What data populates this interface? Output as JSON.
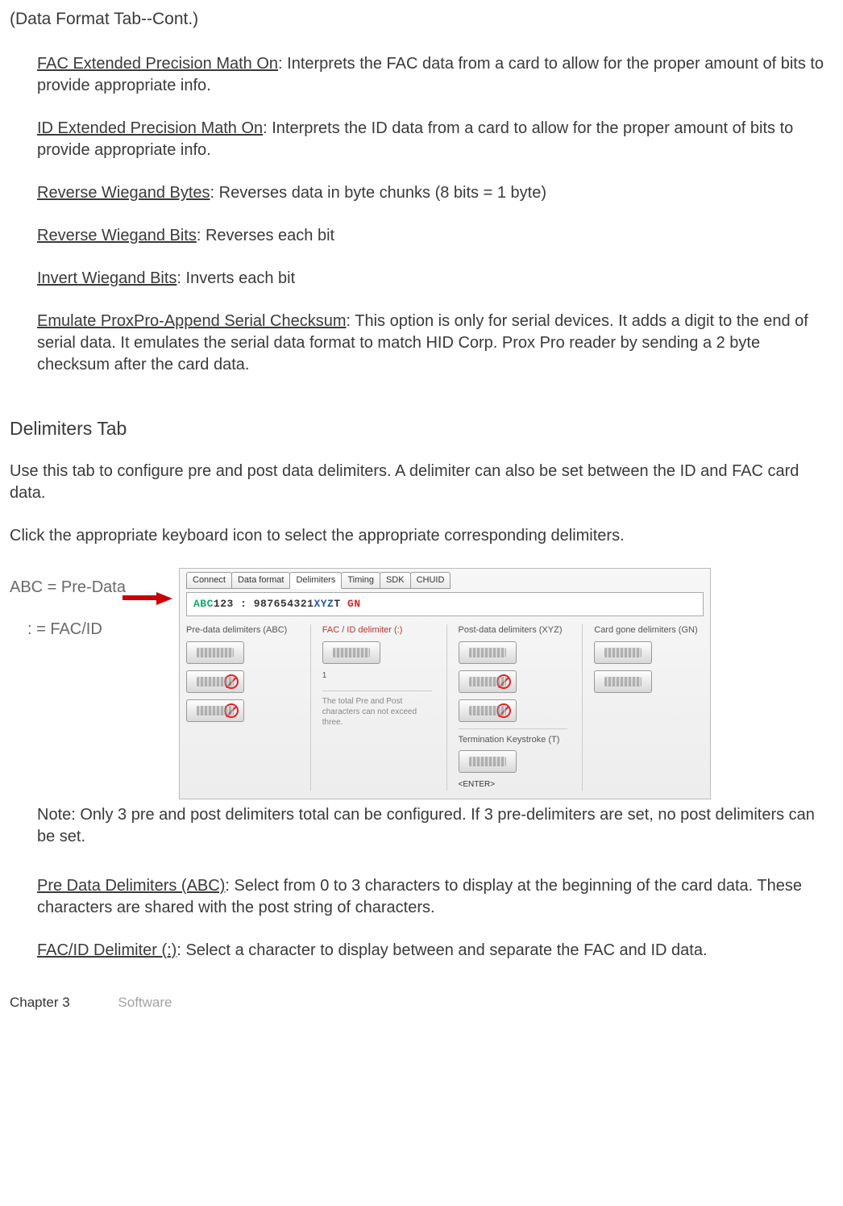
{
  "page_title": "(Data Format Tab--Cont.)",
  "items": [
    {
      "term": "FAC Extended Precision Math On",
      "desc": ": Interprets the FAC data from a card to allow for the proper amount of bits to provide appropriate info."
    },
    {
      "term": "ID Extended Precision Math On",
      "desc": ": Interprets the ID data from a card to allow for the proper amount of bits to provide appropriate info."
    },
    {
      "term": "Reverse Wiegand  Bytes",
      "desc": ": Reverses data in byte chunks (8 bits = 1 byte)"
    },
    {
      "term": "Reverse Wiegand  Bits",
      "desc": ": Reverses each bit"
    },
    {
      "term": "Invert Wiegand Bits",
      "desc": ": Inverts each bit"
    },
    {
      "term": "Emulate ProxPro-Append Serial Checksum",
      "desc": ": This option is only for serial devices. It adds a digit to the end of serial data. It emulates the serial data format to match HID Corp. Prox Pro reader by sending a 2 byte checksum after the card data."
    }
  ],
  "delimiters_heading": "Delimiters Tab",
  "delimiters_p1": "Use this tab to configure pre and post data delimiters. A delimiter can also be set between the ID and FAC card data.",
  "delimiters_p2": "Click the appropriate keyboard icon to select the appropriate corresponding delimiters.",
  "legend": {
    "l1": "ABC = Pre-Data",
    "l2": ": = FAC/ID"
  },
  "ui": {
    "tabs": [
      "Connect",
      "Data format",
      "Delimiters",
      "Timing",
      "SDK",
      "CHUID"
    ],
    "active_tab_index": 2,
    "preview": {
      "abc": "ABC",
      "num": "123",
      "colon": " : ",
      "id": "987654321",
      "xyz": "XYZ",
      "t": "T",
      "gn": "  GN"
    },
    "col1": {
      "title": "Pre-data delimiters (ABC)"
    },
    "col2": {
      "title": "FAC / ID delimiter (:)",
      "field": "1",
      "hint": "The total Pre and Post characters can not exceed three."
    },
    "col3": {
      "title": "Post-data delimiters (XYZ)",
      "term_title": "Termination Keystroke (T)",
      "enter": "<ENTER>"
    },
    "col4": {
      "title": "Card gone delimiters (GN)"
    }
  },
  "note": "Note: Only 3 pre and post delimiters total can be configured. If 3 pre-delimiters are set, no post delimiters can be set.",
  "def1": {
    "term": "Pre Data Delimiters (ABC)",
    "desc": ": Select from 0 to 3 characters to display at the beginning of the card data. These characters are shared with the post string of characters."
  },
  "def2": {
    "term": "FAC/ID Delimiter (:)",
    "desc": ": Select a character to display between and separate the FAC and ID data."
  },
  "footer": {
    "chapter": "Chapter 3",
    "soft": "Software"
  }
}
